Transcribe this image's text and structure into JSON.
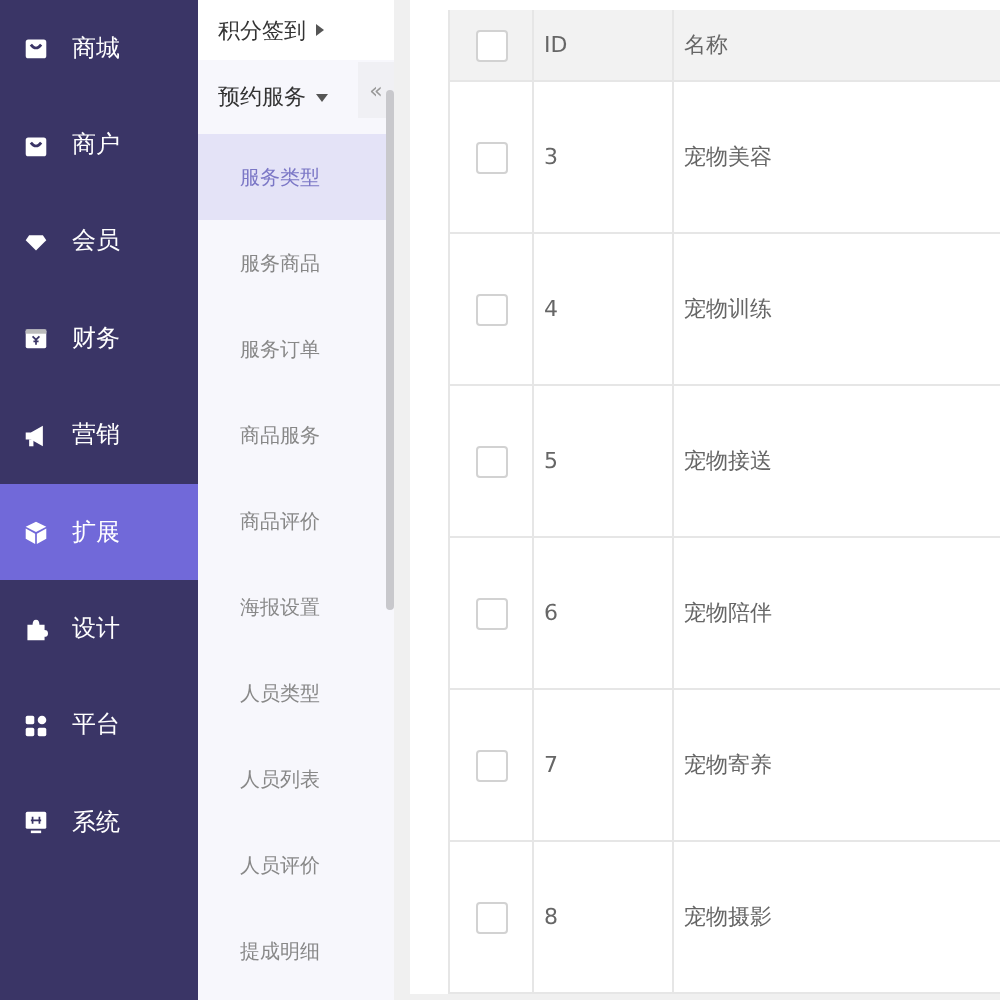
{
  "sidebar": {
    "items": [
      {
        "label": "商城",
        "selected": false
      },
      {
        "label": "商户",
        "selected": false
      },
      {
        "label": "会员",
        "selected": false
      },
      {
        "label": "财务",
        "selected": false
      },
      {
        "label": "营销",
        "selected": false
      },
      {
        "label": "扩展",
        "selected": true
      },
      {
        "label": "设计",
        "selected": false
      },
      {
        "label": "平台",
        "selected": false
      },
      {
        "label": "系统",
        "selected": false
      }
    ]
  },
  "submenu": {
    "collapse_button": "«",
    "groups": [
      {
        "label": "积分签到",
        "expanded": false
      },
      {
        "label": "预约服务",
        "expanded": true,
        "children": [
          {
            "label": "服务类型",
            "selected": true
          },
          {
            "label": "服务商品",
            "selected": false
          },
          {
            "label": "服务订单",
            "selected": false
          },
          {
            "label": "商品服务",
            "selected": false
          },
          {
            "label": "商品评价",
            "selected": false
          },
          {
            "label": "海报设置",
            "selected": false
          },
          {
            "label": "人员类型",
            "selected": false
          },
          {
            "label": "人员列表",
            "selected": false
          },
          {
            "label": "人员评价",
            "selected": false
          },
          {
            "label": "提成明细",
            "selected": false
          }
        ]
      }
    ]
  },
  "table": {
    "header_checked": false,
    "columns": [
      "ID",
      "名称"
    ],
    "rows": [
      {
        "checked": false,
        "id": "3",
        "name": "宠物美容"
      },
      {
        "checked": false,
        "id": "4",
        "name": "宠物训练"
      },
      {
        "checked": false,
        "id": "5",
        "name": "宠物接送"
      },
      {
        "checked": false,
        "id": "6",
        "name": "宠物陪伴"
      },
      {
        "checked": false,
        "id": "7",
        "name": "宠物寄养"
      },
      {
        "checked": false,
        "id": "8",
        "name": "宠物摄影"
      }
    ]
  }
}
